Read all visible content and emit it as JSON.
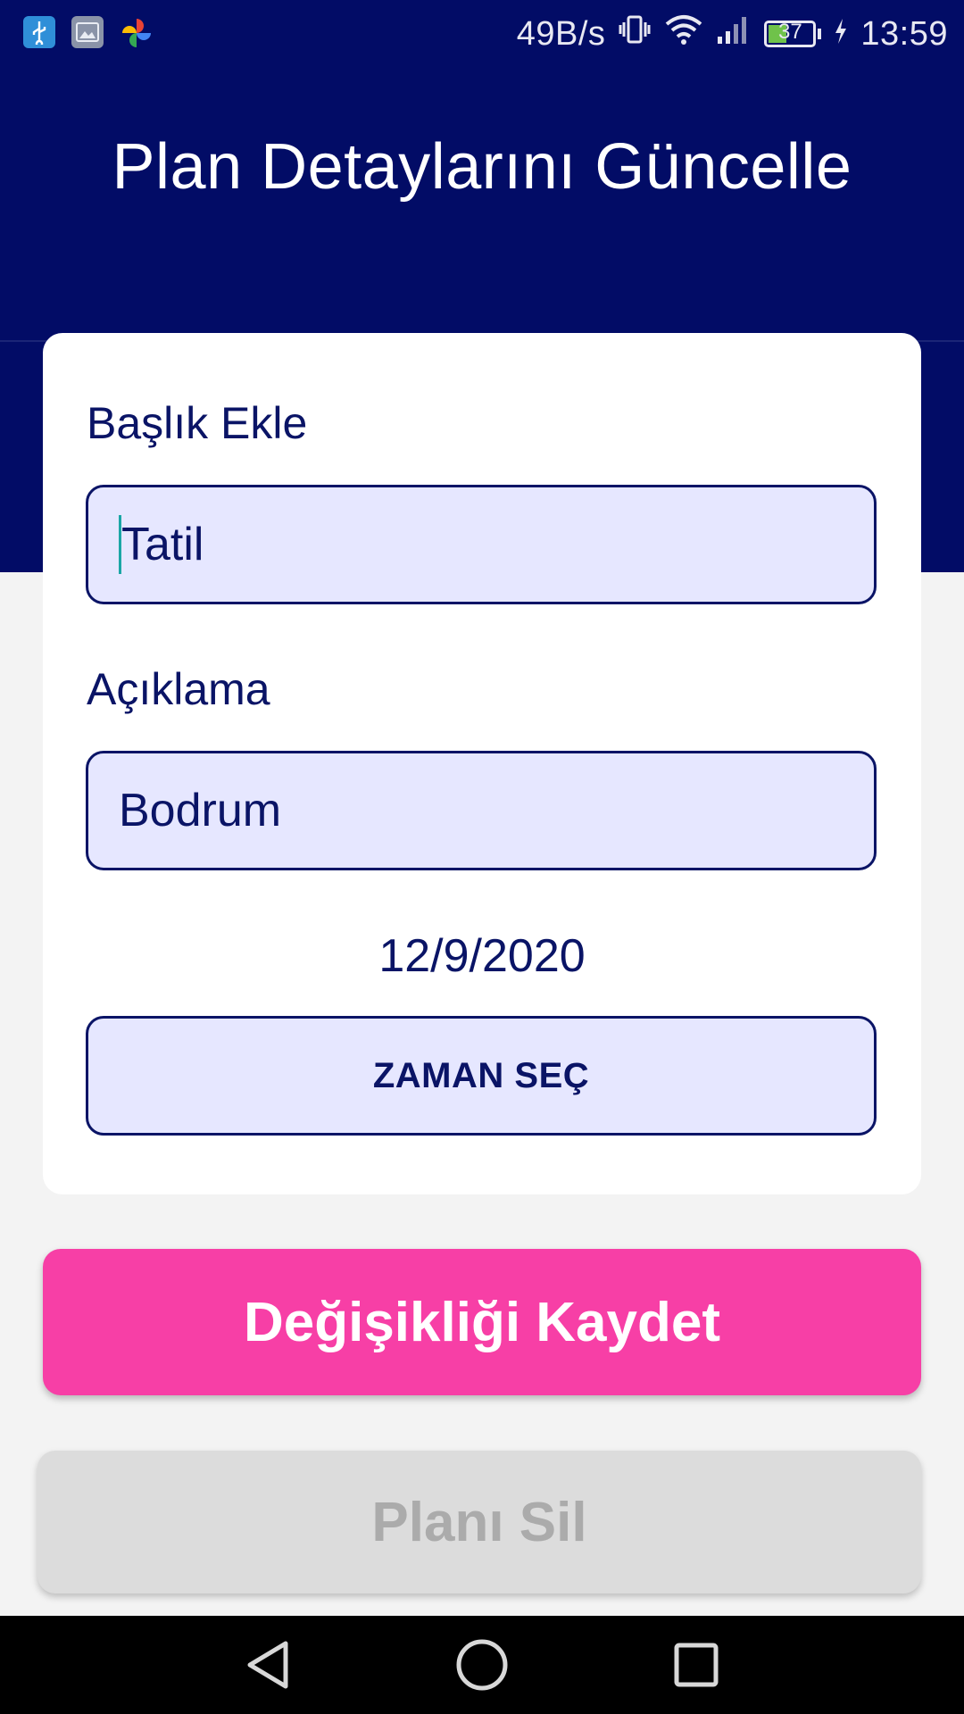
{
  "status_bar": {
    "network_speed": "49B/s",
    "battery_level": "37",
    "time": "13:59",
    "icons": [
      "usb-icon",
      "gallery-icon",
      "pinwheel-icon",
      "vibrate-icon",
      "wifi-icon",
      "signal-icon",
      "battery-icon",
      "charging-icon"
    ]
  },
  "header": {
    "title": "Plan Detaylarını Güncelle"
  },
  "form": {
    "title_label": "Başlık Ekle",
    "title_value": "Tatil",
    "description_label": "Açıklama",
    "description_value": "Bodrum",
    "date": "12/9/2020",
    "time_button_label": "ZAMAN SEÇ"
  },
  "actions": {
    "save_label": "Değişikliği Kaydet",
    "delete_label": "Planı Sil"
  },
  "nav_bar": {
    "icons": [
      "back-icon",
      "home-icon",
      "recent-apps-icon"
    ]
  },
  "colors": {
    "header_navy": "#020c66",
    "field_bg": "#e6e7ff",
    "accent_pink": "#f73fa6",
    "disabled_gray": "#dcdcdc"
  }
}
